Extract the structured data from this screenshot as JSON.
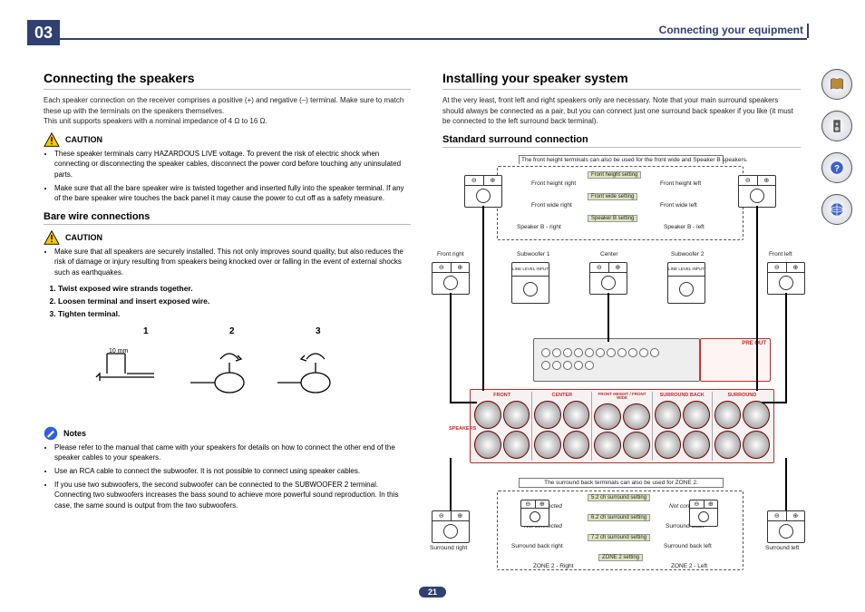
{
  "chapter": {
    "number": "03",
    "title": "Connecting your equipment"
  },
  "page_number": "21",
  "left": {
    "h1": "Connecting the speakers",
    "intro": "Each speaker connection on the receiver comprises a positive (+) and negative (–) terminal. Make sure to match these up with the terminals on the speakers themselves.\nThis unit supports speakers with a nominal impedance of 4 Ω to 16 Ω.",
    "caution_label": "CAUTION",
    "caution1": [
      "These speaker terminals carry HAZARDOUS LIVE voltage. To prevent the risk of electric shock when connecting or disconnecting the speaker cables, disconnect the power cord before touching any uninsulated parts.",
      "Make sure that all the bare speaker wire is twisted together and inserted fully into the speaker terminal. If any of the bare speaker wire touches the back panel it may cause the power to cut off as a safety measure."
    ],
    "h2": "Bare wire connections",
    "caution2": [
      "Make sure that all speakers are securely installed. This not only improves sound quality, but also reduces the risk of damage or injury resulting from speakers being knocked over or falling in the event of external shocks such as earthquakes."
    ],
    "steps": [
      "Twist exposed wire strands together.",
      "Loosen terminal and insert exposed wire.",
      "Tighten terminal."
    ],
    "fig": {
      "l1": "1",
      "l2": "2",
      "l3": "3",
      "mm": "10 mm"
    },
    "notes_label": "Notes",
    "notes": [
      "Please refer to the manual that came with your speakers for details on how to connect the other end of the speaker cables to your speakers.",
      "Use an RCA cable to connect the subwoofer. It is not possible to connect using speaker cables.",
      "If you use two subwoofers, the second subwoofer can be connected to the SUBWOOFER 2 terminal. Connecting two subwoofers increases the bass sound to achieve more powerful sound reproduction. In this case, the same sound is output from the two subwoofers."
    ]
  },
  "right": {
    "h1": "Installing your speaker system",
    "intro": "At the very least, front left and right speakers only are necessary. Note that your main surround speakers should always be connected as a pair, but you can connect just one surround back speaker if you like (it must be connected to the left surround back terminal).",
    "h2": "Standard surround connection",
    "top_note": "The front height terminals can also be used for the front wide and Speaker B speakers.",
    "labels": {
      "fhr": "Front height right",
      "fhl": "Front height left",
      "fwr": "Front wide right",
      "fwl": "Front wide left",
      "sbr": "Speaker B - right",
      "sbl": "Speaker B - left",
      "fr": "Front right",
      "fl": "Front left",
      "sub1": "Subwoofer 1",
      "sub2": "Subwoofer 2",
      "center": "Center",
      "sr": "Surround right",
      "sl": "Surround left",
      "sbkr": "Surround back right",
      "sbkl": "Surround back left",
      "sb": "Surround back",
      "nc": "Not connected",
      "z2r": "ZONE 2 - Right",
      "z2l": "ZONE 2 - Left",
      "preout": "PRE OUT",
      "line_level": "LINE LEVEL INPUT"
    },
    "settings": {
      "fh": "Front height setting",
      "fw": "Front wide setting",
      "sb": "Speaker B setting",
      "s52": "5.2 ch surround setting",
      "s62": "6.2 ch surround setting",
      "s72": "7.2 ch surround setting",
      "z2": "ZONE 2 setting"
    },
    "terminal_heads": [
      "FRONT",
      "CENTER",
      "FRONT HEIGHT / FRONT WIDE",
      "SURROUND BACK",
      "SURROUND"
    ],
    "speakers_label": "SPEAKERS",
    "bottom_note": "The surround back terminals can also be used for ZONE 2."
  },
  "nav": [
    "book",
    "speaker",
    "help",
    "network"
  ]
}
